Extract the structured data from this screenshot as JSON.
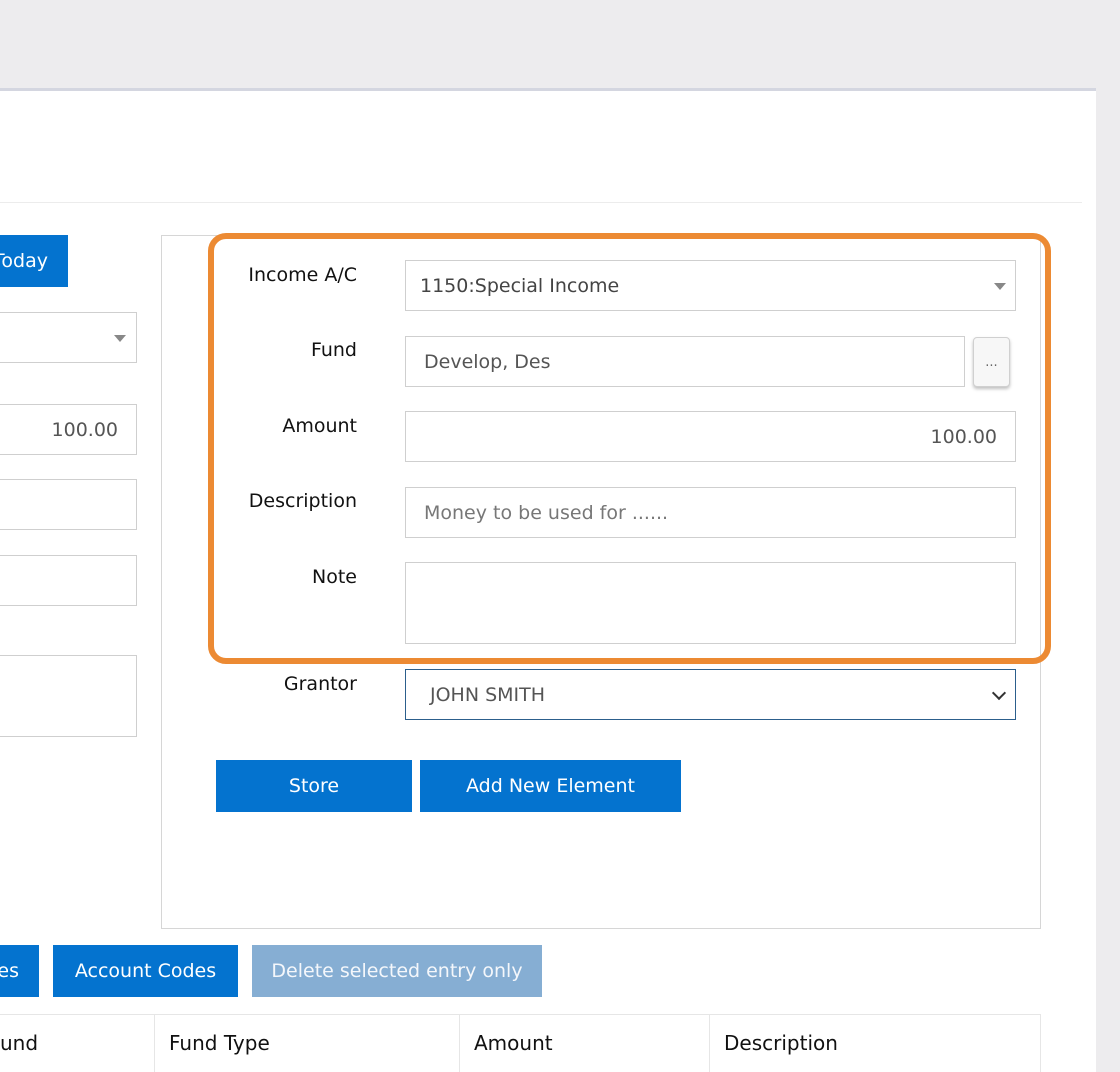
{
  "left_form": {
    "today_button": "Today",
    "amount_value": "100.00"
  },
  "entry_form": {
    "income_ac": {
      "label": "Income A/C",
      "value": "1150:Special Income"
    },
    "fund": {
      "label": "Fund",
      "value": "Develop, Des",
      "lookup_button": "..."
    },
    "amount": {
      "label": "Amount",
      "value": "100.00"
    },
    "description": {
      "label": "Description",
      "placeholder": "Money to be used for ......"
    },
    "note": {
      "label": "Note",
      "value": ""
    },
    "grantor": {
      "label": "Grantor",
      "value": "JOHN SMITH"
    },
    "store_button": "Store",
    "add_new_button": "Add New Element"
  },
  "toolbar": {
    "partial_button": "es",
    "account_codes_button": "Account Codes",
    "delete_button": "Delete selected entry only"
  },
  "table": {
    "columns": [
      "und",
      "Fund Type",
      "Amount",
      "Description"
    ]
  },
  "colors": {
    "primary": "#0473cf",
    "disabled": "#86aed3",
    "highlight": "#ec8a33"
  }
}
